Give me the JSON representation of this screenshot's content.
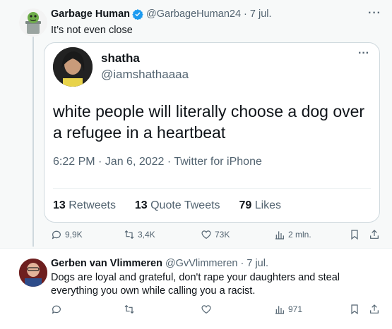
{
  "tweet1": {
    "author_name": "Garbage Human",
    "author_handle": "@GarbageHuman24",
    "date": "· 7 jul.",
    "more": "···",
    "text": "It’s not even close",
    "quote": {
      "name": "shatha",
      "handle": "@iamshathaaaa",
      "more": "···",
      "text": "white people will literally choose a dog over a refugee in a heartbeat",
      "time": "6:22 PM · Jan 6, 2022 · Twitter for iPhone",
      "retweets_count": "13",
      "retweets_label": "Retweets",
      "quotes_count": "13",
      "quotes_label": "Quote Tweets",
      "likes_count": "79",
      "likes_label": "Likes"
    },
    "actions": {
      "replies": "9,9K",
      "retweets": "3,4K",
      "likes": "73K",
      "views": "2 mln."
    }
  },
  "tweet2": {
    "author_name": "Gerben van Vlimmeren",
    "author_handle": "@GvVlimmeren",
    "date": "· 7 jul.",
    "text": "Dogs are loyal and grateful, don't rape your daughters and steal everything you own while calling you a racist.",
    "actions": {
      "replies": "",
      "retweets": "",
      "likes": "",
      "views": "971"
    }
  },
  "colors": {
    "verified": "#1d9bf0",
    "secondary_text": "#536471",
    "border": "#cfd9de"
  }
}
